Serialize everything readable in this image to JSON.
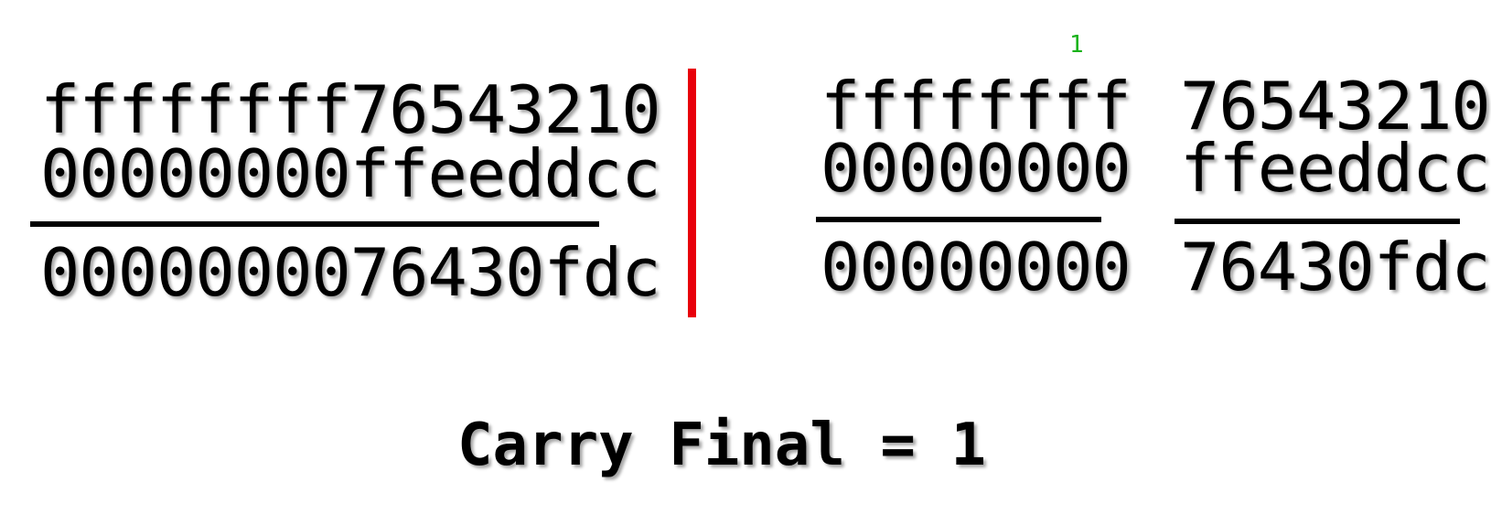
{
  "left_sum": {
    "operand_a": "ffffffff76543210",
    "operand_b": "00000000ffeeddcc",
    "result": "0000000076430fdc"
  },
  "right_sum": {
    "high": {
      "carry_in": "1",
      "operand_a": "ffffffff",
      "operand_b": "00000000",
      "result": "00000000"
    },
    "low": {
      "operand_a": "76543210",
      "operand_b": "ffeeddcc",
      "result": "76430fdc"
    }
  },
  "footer": {
    "carry_final": "Carry Final = 1"
  },
  "colors": {
    "divider": "#e8000b",
    "carry_digit": "#19b21a",
    "text": "#000000"
  }
}
